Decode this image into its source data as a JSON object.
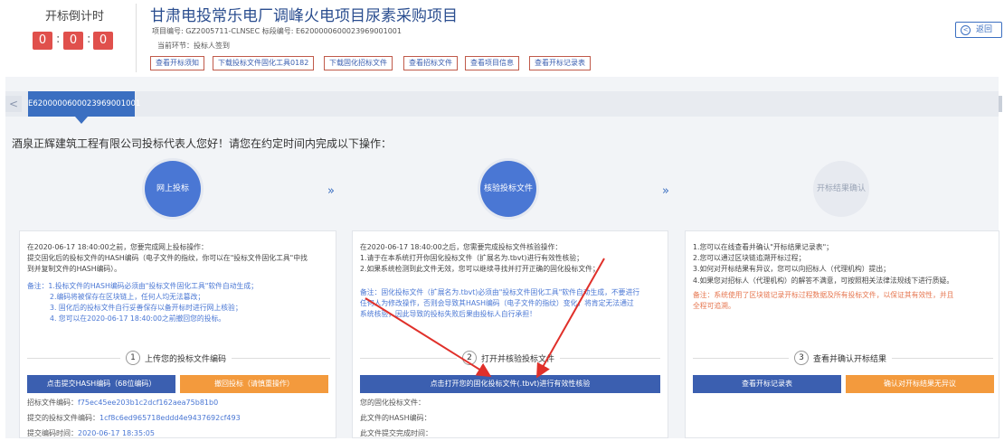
{
  "timer": {
    "title": "开标倒计时",
    "digits": [
      "0",
      "0",
      "0"
    ],
    "colon": ":"
  },
  "project": {
    "title": "甘肃电投常乐电厂调峰火电项目尿素采购项目",
    "meta": "项目编号: GZ2005711-CLNSEC    标段编号: E6200000600023969001001",
    "stage": "当前环节：投标人签到"
  },
  "toolbar": [
    "查看开标须知",
    "下载投标文件固化工具0182",
    "下载固化招标文件",
    "查看招标文件",
    "查看项目信息",
    "查看开标记录表"
  ],
  "back_label": "返回",
  "back_icon": "<",
  "tab": {
    "label": "E6200000600023969001001",
    "prev_arrow": "<"
  },
  "greeting": "酒泉正辉建筑工程有限公司投标代表人您好！请您在约定时间内完成以下操作：",
  "steps": [
    "网上投标",
    "核验投标文件",
    "开标结果确认"
  ],
  "arrow_glyph": "»",
  "panel1": {
    "lines": [
      "在2020-06-17 18:40:00之前，您要完成网上投标操作：",
      "提交固化后的投标文件的HASH编码（电子文件的指纹，你可以在\"投标文件固化工具\"中找",
      "到并复制文件的HASH编码）。"
    ],
    "notes": [
      "备注：1.投标文件的HASH编码必须由\"投标文件固化工具\"软件自动生成；",
      "2.编码将被保存在区块链上，任何人均无法篡改；",
      "3. 固化后的投标文件自行妥善保存以备开标时进行网上核验；",
      "4. 您可以在2020-06-17 18:40:00之前撤回您的投标。"
    ],
    "section_num": "1",
    "section_title": "上传您的投标文件编码",
    "btn_submit": "点击提交HASH编码（68位编码）",
    "btn_withdraw": "撤回投标（请慎重操作）",
    "info": [
      {
        "label": "招标文件编码：",
        "value": "f75ec45ee203b1c2dcf162aea75b81b0"
      },
      {
        "label": "提交的投标文件编码：",
        "value": "1cf8c6ed965718eddd4e9437692cf493"
      },
      {
        "label": "提交编码时间：",
        "value": "2020-06-17 18:35:05"
      }
    ]
  },
  "panel2": {
    "lines": [
      "在2020-06-17 18:40:00之后，您需要完成投标文件核验操作：",
      "1.请于在本系统打开你固化投标文件（扩展名为.tbvt)进行有效性核验；",
      "2.如果系统检测到此文件无效，您可以继续寻找并打开正确的固化投标文件；"
    ],
    "notes": [
      "备注：固化投标文件（扩展名为.tbvt)必须由\"投标文件固化工具\"软件自动生成，不要进行",
      "任何人为修改操作，否则会导致其HASH编码（电子文件的指纹）变化，将肯定无法通过",
      "系统核验，因此导致的投标失败后果由投标人自行承担！"
    ],
    "section_num": "2",
    "section_title": "打开并核验投标文件",
    "btn_open": "点击打开您的固化投标文件(.tbvt)进行有效性核验",
    "info": [
      "您的固化投标文件：",
      "此文件的HASH编码：",
      "此文件提交完成时间："
    ]
  },
  "panel3": {
    "lines": [
      "1.您可以在线查看并确认\"开标结果记录表\"；",
      "2.您可以通过区块链追溯开标过程；",
      "3.如何对开标结果有异议，您可以向招标人（代理机构）提出；",
      "4.如果您对招标人（代理机构）的解答不满意，可按照相关法律法规线下进行质疑。"
    ],
    "notes": [
      "备注：系统使用了区块链记录开标过程数据及所有投标文件，以保证其有效性，并且",
      "全程可追溯。"
    ],
    "section_num": "3",
    "section_title": "查看并确认开标结果",
    "btn_record": "查看开标记录表",
    "btn_confirm": "确认对开标结果无异议"
  },
  "colors": {
    "accent": "#3b6fc1",
    "danger": "#e0504c",
    "orange": "#f39a3d",
    "note_red": "#e6764f"
  }
}
